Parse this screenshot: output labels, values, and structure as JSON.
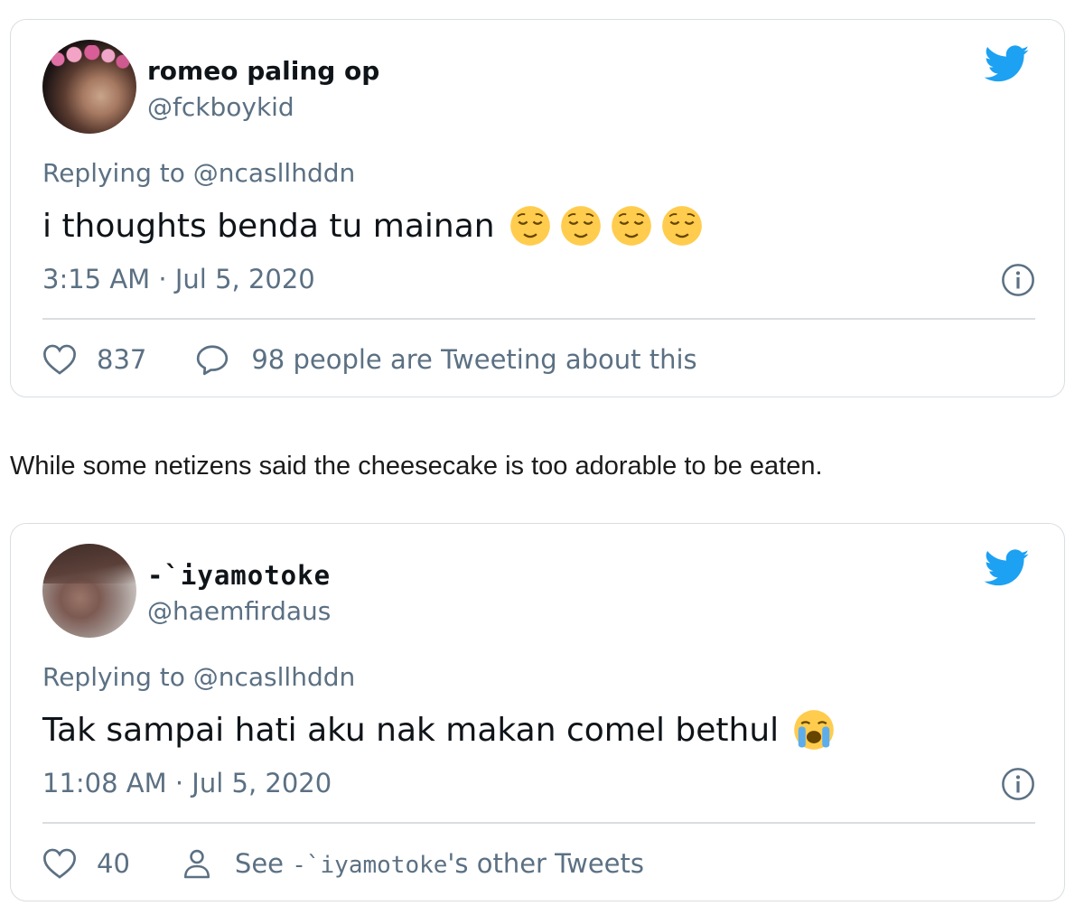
{
  "tweets": [
    {
      "display_name": "romeo paling op",
      "handle": "@fckboykid",
      "replying_to": "Replying to @ncasllhddn",
      "text": "i thoughts benda tu mainan",
      "emojis": [
        "relieved-face",
        "relieved-face",
        "relieved-face",
        "relieved-face"
      ],
      "timestamp": "3:15 AM · Jul 5, 2020",
      "likes": "837",
      "secondary_action_label": "98 people are Tweeting about this",
      "secondary_action_icon": "comment-bubble-icon"
    },
    {
      "display_name": "-`iyamotoke",
      "handle": "@haemfirdaus",
      "replying_to": "Replying to @ncasllhddn",
      "text": "Tak sampai hati aku nak makan comel bethul",
      "emojis": [
        "loudly-crying-face"
      ],
      "timestamp": "11:08 AM · Jul 5, 2020",
      "likes": "40",
      "secondary_action_prefix": "See ",
      "secondary_action_name": "-`iyamotoke",
      "secondary_action_suffix": "'s other Tweets",
      "secondary_action_icon": "person-icon"
    }
  ],
  "article_text": "While some netizens said the cheesecake is too adorable to be eaten.",
  "colors": {
    "twitter_blue": "#1da1f2",
    "secondary_text": "#5b7083",
    "border": "#d9dee2"
  }
}
